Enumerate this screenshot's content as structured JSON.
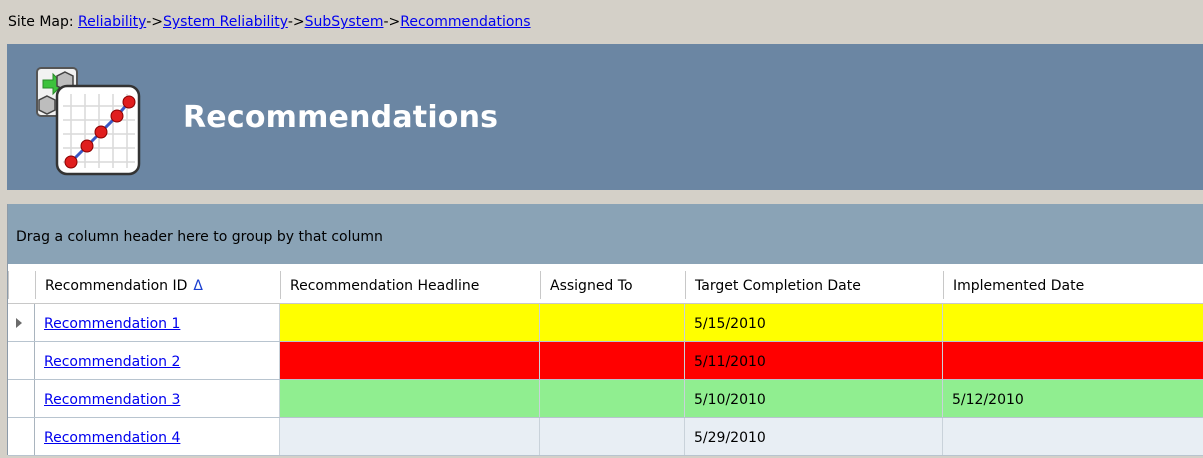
{
  "sitemap": {
    "label": "Site Map:",
    "crumbs": [
      "Reliability",
      "System Reliability",
      "SubSystem",
      "Recommendations"
    ],
    "separator": "->"
  },
  "banner": {
    "title": "Recommendations",
    "background": "#6b86a3"
  },
  "grid": {
    "group_hint": "Drag a column header here to group by that column",
    "columns": [
      "Recommendation ID",
      "Recommendation Headline",
      "Assigned To",
      "Target Completion Date",
      "Implemented Date"
    ],
    "sort_indicator": "Δ",
    "rows": [
      {
        "id": "Recommendation 1",
        "headline": "",
        "assigned_to": "",
        "target_date": "5/15/2010",
        "implemented_date": "",
        "color": "#ffff00",
        "selected": true
      },
      {
        "id": "Recommendation 2",
        "headline": "",
        "assigned_to": "",
        "target_date": "5/11/2010",
        "implemented_date": "",
        "color": "#ff0000",
        "selected": false
      },
      {
        "id": "Recommendation 3",
        "headline": "",
        "assigned_to": "",
        "target_date": "5/10/2010",
        "implemented_date": "5/12/2010",
        "color": "#90ee90",
        "selected": false
      },
      {
        "id": "Recommendation 4",
        "headline": "",
        "assigned_to": "",
        "target_date": "5/29/2010",
        "implemented_date": "",
        "color": "#e8eef4",
        "selected": false
      }
    ]
  }
}
